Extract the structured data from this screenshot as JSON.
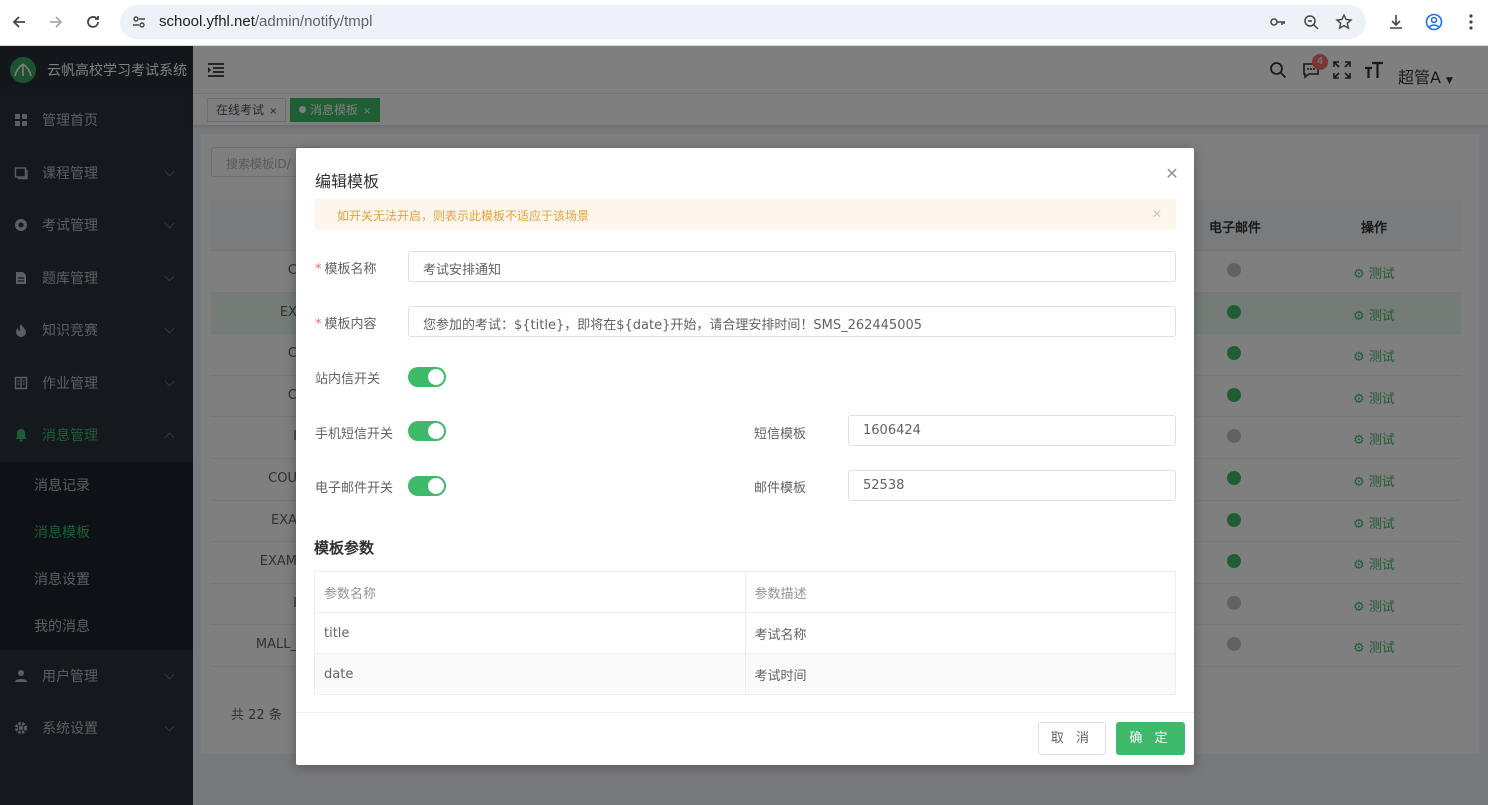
{
  "browser": {
    "url_host": "school.yfhl.net",
    "url_path": "/admin/notify/tmpl"
  },
  "app": {
    "title": "云帆高校学习考试系统",
    "user": "超管A",
    "notification_count": "4"
  },
  "sidebar": {
    "items": [
      {
        "label": "管理首页",
        "icon": "dashboard-icon"
      },
      {
        "label": "课程管理",
        "icon": "book-icon"
      },
      {
        "label": "考试管理",
        "icon": "exam-icon"
      },
      {
        "label": "题库管理",
        "icon": "question-bank-icon"
      },
      {
        "label": "知识竞赛",
        "icon": "fire-icon"
      },
      {
        "label": "作业管理",
        "icon": "homework-icon"
      },
      {
        "label": "消息管理",
        "icon": "bell-icon"
      }
    ],
    "sub_items": [
      "消息记录",
      "消息模板",
      "消息设置",
      "我的消息"
    ],
    "bottom_items": [
      {
        "label": "用户管理",
        "icon": "user-icon"
      },
      {
        "label": "系统设置",
        "icon": "gear-icon"
      }
    ]
  },
  "tabs": [
    {
      "label": "在线考试"
    },
    {
      "label": "消息模板"
    }
  ],
  "background": {
    "search_placeholder": "搜索模板ID/",
    "col_email": "电子邮件",
    "col_action": "操作",
    "row_codes": [
      "C",
      "EX",
      "C",
      "C",
      "I",
      "COU",
      "EXA",
      "EXAM",
      "I",
      "MALL_"
    ],
    "email_status": [
      "off",
      "on",
      "on",
      "on",
      "off",
      "on",
      "on",
      "on",
      "off",
      "off"
    ],
    "test_label": "测试",
    "total": "共 22 条"
  },
  "dialog": {
    "title": "编辑模板",
    "alert": "如开关无法开启，则表示此模板不适应于该场景",
    "name_label": "模板名称",
    "name_value": "考试安排通知",
    "content_label": "模板内容",
    "content_value": "您参加的考试：${title}，即将在${date}开始，请合理安排时间！SMS_262445005",
    "site_switch_label": "站内信开关",
    "sms_switch_label": "手机短信开关",
    "sms_tmpl_label": "短信模板",
    "sms_tmpl_value": "1606424",
    "email_switch_label": "电子邮件开关",
    "email_tmpl_label": "邮件模板",
    "email_tmpl_value": "52538",
    "params_title": "模板参数",
    "params_header": [
      "参数名称",
      "参数描述"
    ],
    "params": [
      [
        "title",
        "考试名称"
      ],
      [
        "date",
        "考试时间"
      ]
    ],
    "cancel": "取 消",
    "ok": "确 定"
  },
  "colors": {
    "brand": "#3fba6a",
    "sidebar": "#2a323c",
    "warning": "#e6a23c"
  }
}
